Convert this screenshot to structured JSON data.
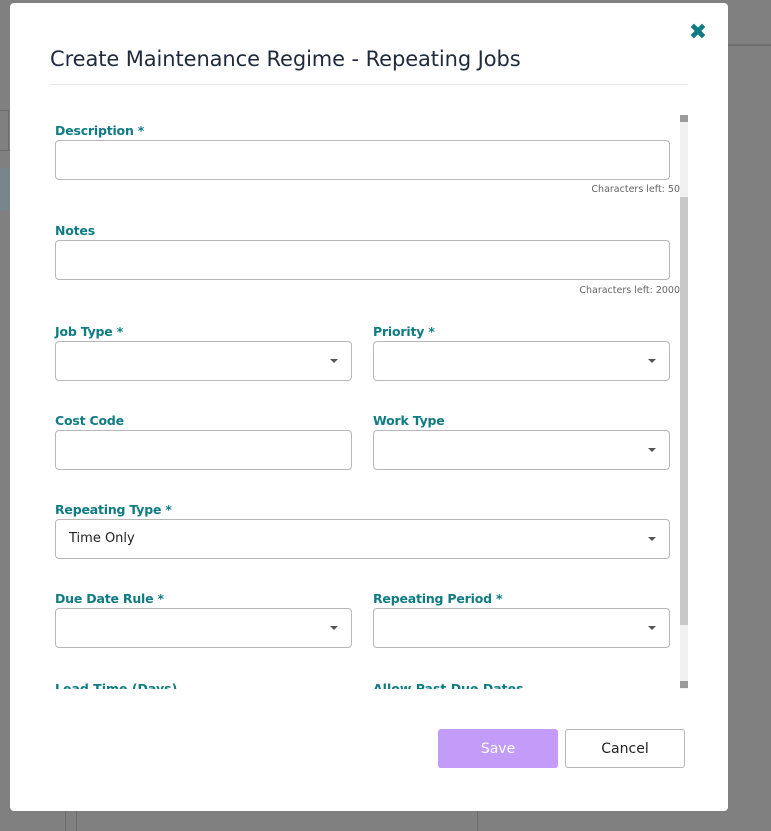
{
  "modal": {
    "title": "Create Maintenance Regime - Repeating Jobs",
    "close_icon": "close-icon"
  },
  "form": {
    "description": {
      "label": "Description *",
      "value": "",
      "counter": "Characters left: 50"
    },
    "notes": {
      "label": "Notes",
      "value": "",
      "counter": "Characters left: 2000"
    },
    "job_type": {
      "label": "Job Type *",
      "value": ""
    },
    "priority": {
      "label": "Priority *",
      "value": ""
    },
    "cost_code": {
      "label": "Cost Code",
      "value": ""
    },
    "work_type": {
      "label": "Work Type",
      "value": ""
    },
    "repeating_type": {
      "label": "Repeating Type *",
      "value": "Time Only"
    },
    "due_date_rule": {
      "label": "Due Date Rule *",
      "value": ""
    },
    "repeating_period": {
      "label": "Repeating Period *",
      "value": ""
    },
    "lead_time": {
      "label": "Lead Time (Days)"
    },
    "allow_past_due": {
      "label": "Allow Past Due Dates"
    }
  },
  "buttons": {
    "save": "Save",
    "cancel": "Cancel"
  },
  "colors": {
    "accent": "#0f7b82",
    "save_bg": "#c39bf8"
  }
}
